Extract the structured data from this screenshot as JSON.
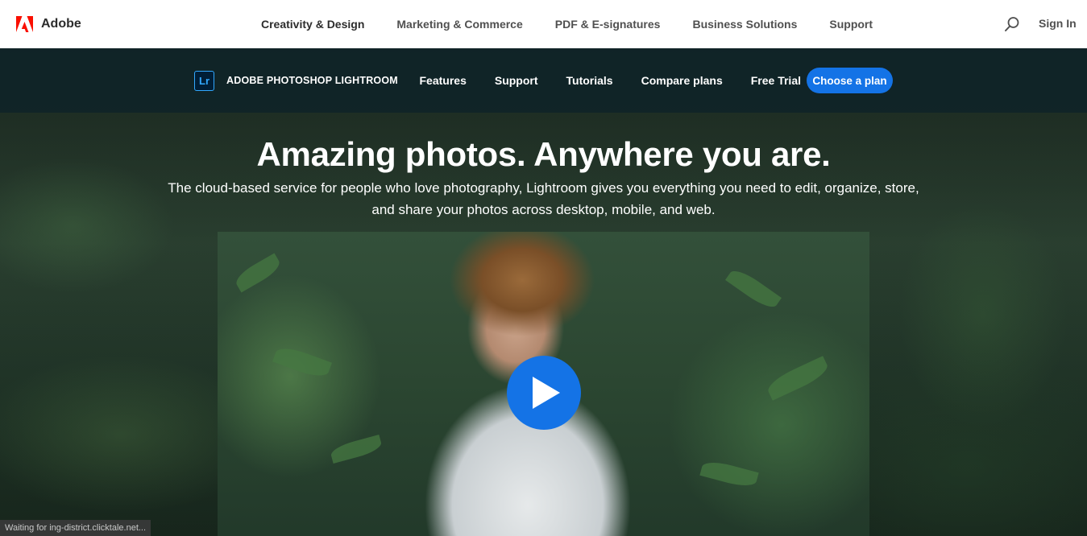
{
  "global_nav": {
    "brand": "Adobe",
    "links": [
      {
        "label": "Creativity & Design"
      },
      {
        "label": "Marketing & Commerce"
      },
      {
        "label": "PDF & E-signatures"
      },
      {
        "label": "Business Solutions"
      },
      {
        "label": "Support"
      }
    ],
    "search_icon": "search-icon",
    "signin": "Sign In"
  },
  "product_nav": {
    "badge": "Lr",
    "product_name": "ADOBE PHOTOSHOP LIGHTROOM",
    "links": [
      {
        "label": "Features"
      },
      {
        "label": "Support"
      },
      {
        "label": "Tutorials"
      },
      {
        "label": "Compare plans"
      },
      {
        "label": "Free Trial"
      }
    ],
    "cta": "Choose a plan"
  },
  "hero": {
    "headline": "Amazing photos. Anywhere you are.",
    "subtext": "The cloud-based service for people who love photography, Lightroom gives you everything you need to edit, organize, store, and share your photos across desktop, mobile, and web.",
    "video": {
      "play_icon": "play-icon"
    }
  },
  "status_bar": {
    "text": "Waiting for ing-district.clicktale.net..."
  },
  "colors": {
    "adobe_red": "#fa0f00",
    "cta_blue": "#1473e6",
    "lr_blue": "#31a8ff",
    "subnav_bg": "#10242a"
  }
}
